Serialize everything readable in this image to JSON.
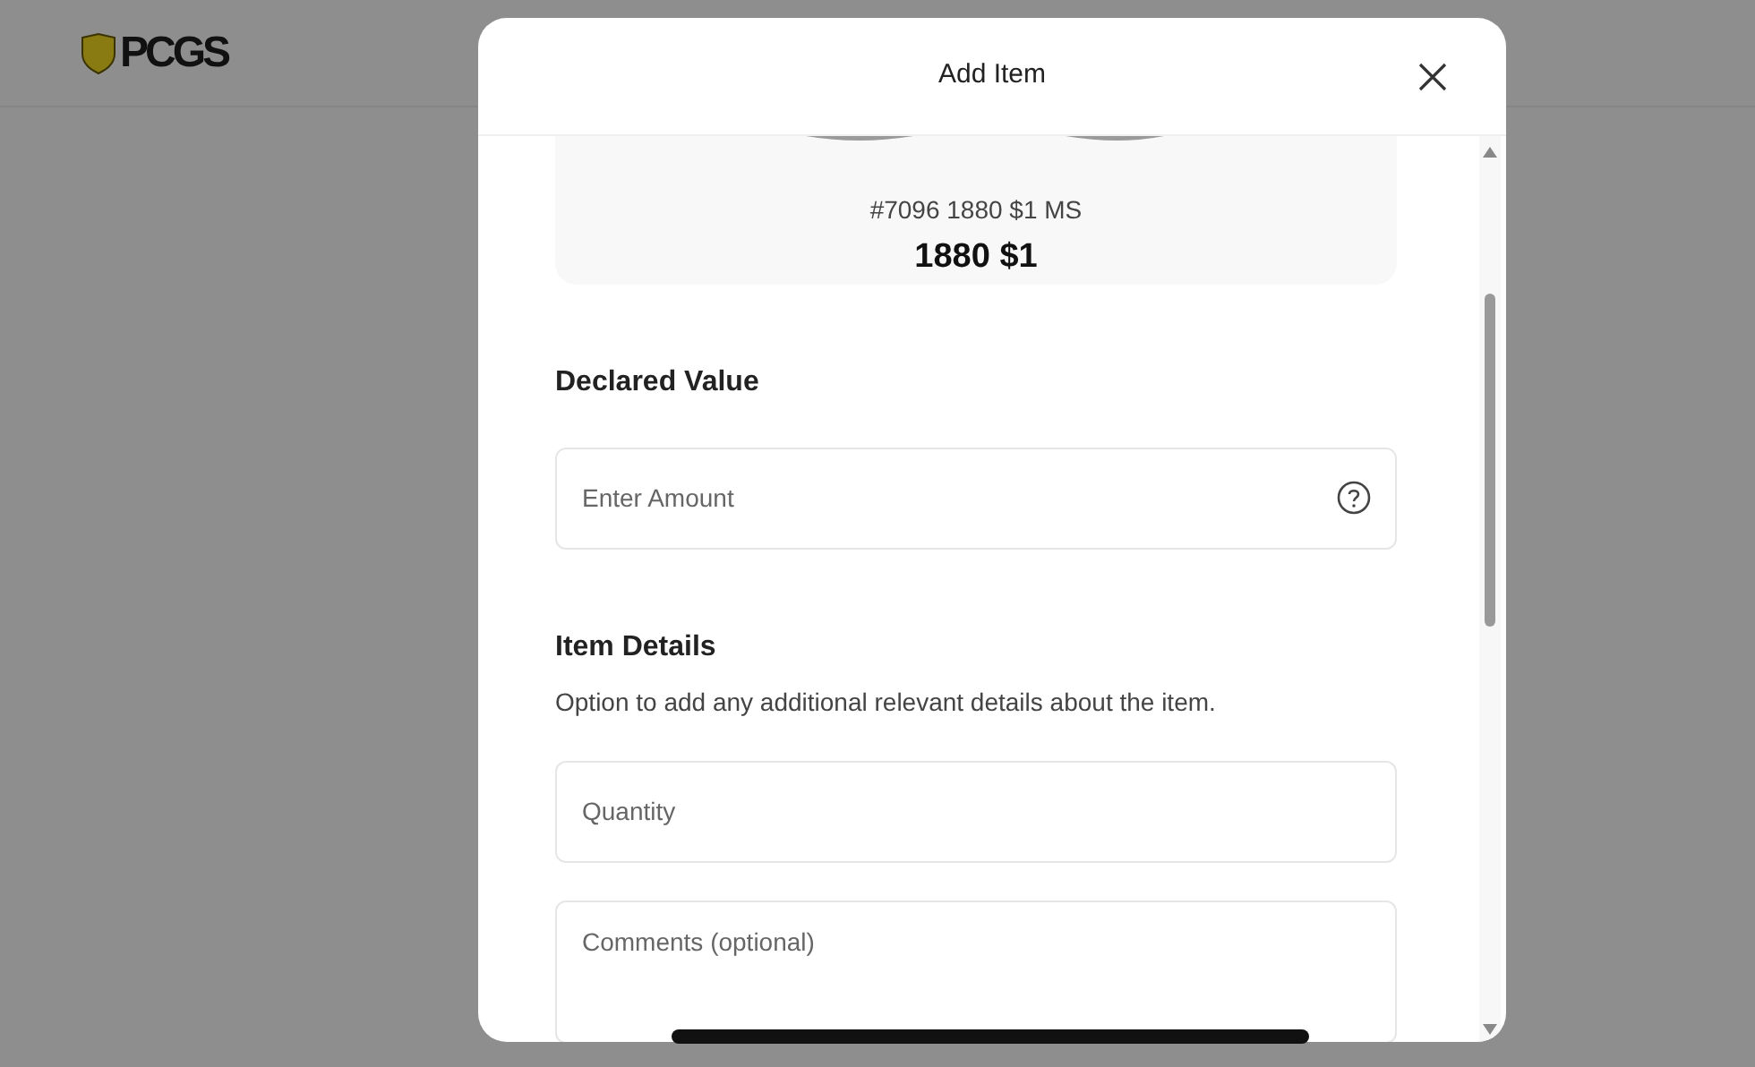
{
  "header": {
    "logo": "PCGS"
  },
  "modal": {
    "title": "Add Item",
    "item": {
      "number": "#7096 1880 $1 MS",
      "name": "1880 $1"
    },
    "declared_value": {
      "label": "Declared Value",
      "placeholder": "Enter Amount"
    },
    "item_details": {
      "label": "Item Details",
      "description": "Option to add any additional relevant details about the item.",
      "fields": [
        {
          "kind": "input",
          "placeholder": "Quantity"
        },
        {
          "kind": "textarea",
          "placeholder": "Comments (optional)"
        }
      ]
    }
  }
}
